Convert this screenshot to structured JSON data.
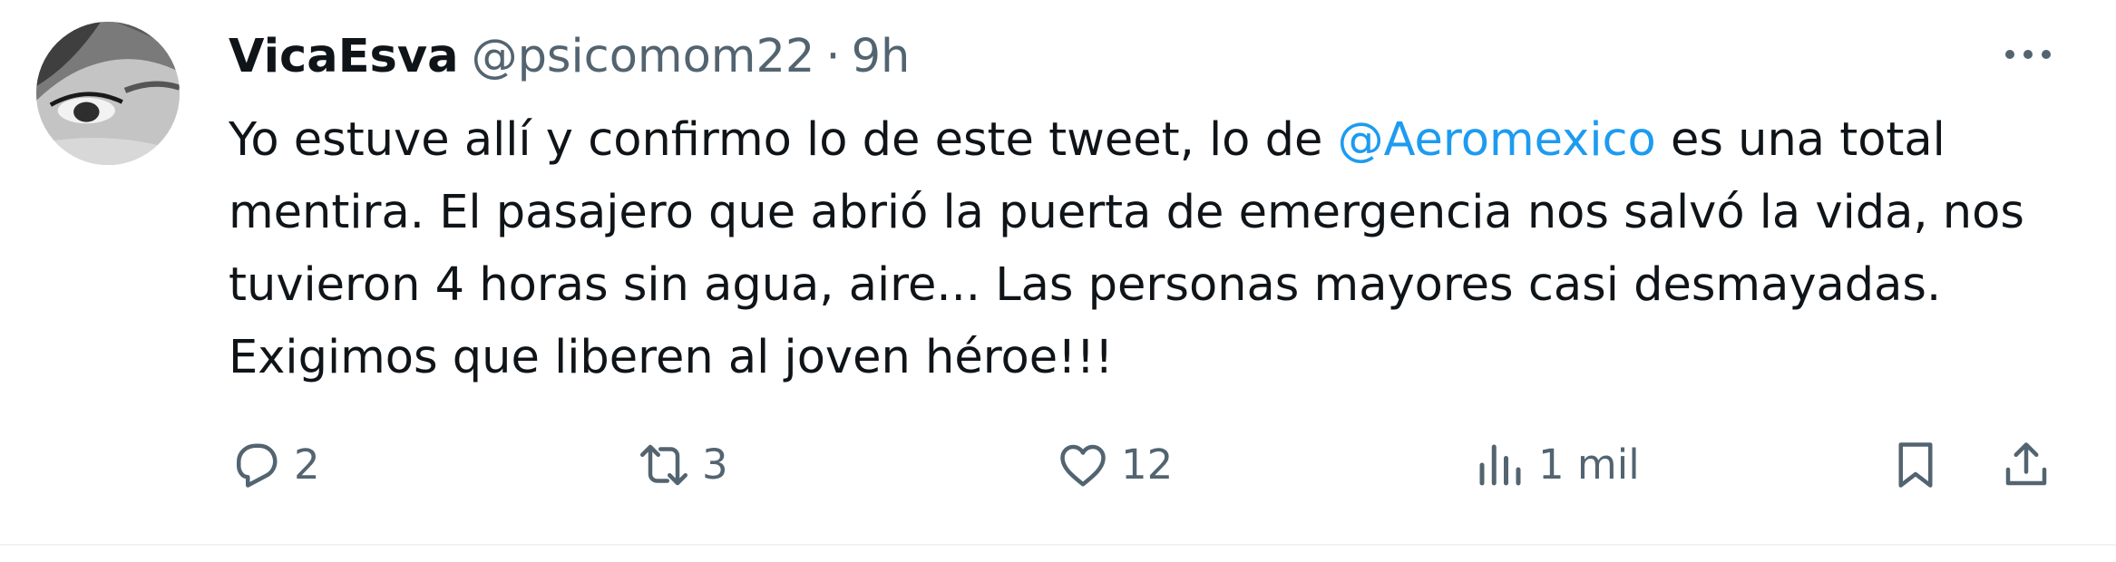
{
  "tweet": {
    "author": {
      "display_name": "VicaEsva",
      "handle": "@psicomom22"
    },
    "separator": "·",
    "time": "9h",
    "text": {
      "line1_before": "Yo estuve allí y confirmo lo de este tweet, lo de ",
      "mention": "@Aeromexico",
      "line1_after": " es una total",
      "line2": "mentira. El pasajero que abrió la puerta de emergencia nos salvó la vida, nos",
      "line3": "tuvieron 4 horas sin agua, aire... Las personas mayores casi desmayadas.",
      "line4": "Exigimos que liberen al joven héroe!!!"
    },
    "actions": {
      "replies": "2",
      "retweets": "3",
      "likes": "12",
      "views": "1 mil"
    },
    "icons": [
      "more-icon",
      "reply-icon",
      "retweet-icon",
      "like-icon",
      "views-icon",
      "bookmark-icon",
      "share-icon"
    ]
  },
  "colors": {
    "text": "#0f1419",
    "secondary": "#536471",
    "link": "#1d9bf0",
    "divider": "#eff3f4"
  }
}
